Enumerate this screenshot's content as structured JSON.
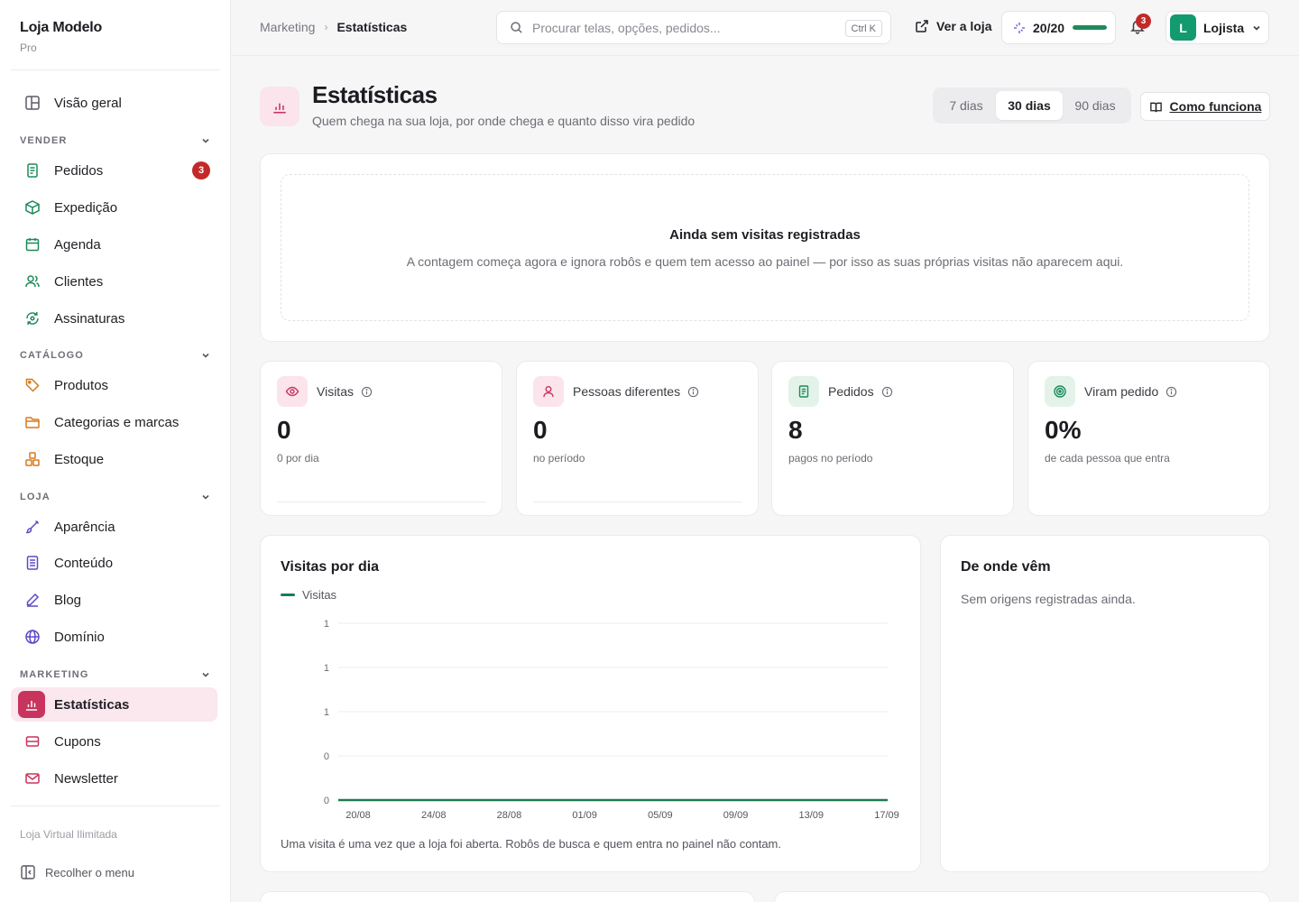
{
  "brand": {
    "name": "Loja Modelo",
    "plan": "Pro"
  },
  "sidebar": {
    "overview": "Visão geral",
    "sections": [
      {
        "title": "VENDER",
        "items": [
          {
            "label": "Pedidos",
            "icon": "receipt-icon",
            "badge": "3"
          },
          {
            "label": "Expedição",
            "icon": "box-icon"
          },
          {
            "label": "Agenda",
            "icon": "calendar-icon"
          },
          {
            "label": "Clientes",
            "icon": "users-icon"
          },
          {
            "label": "Assinaturas",
            "icon": "refresh-icon"
          }
        ]
      },
      {
        "title": "CATÁLOGO",
        "items": [
          {
            "label": "Produtos",
            "icon": "tag-icon"
          },
          {
            "label": "Categorias e marcas",
            "icon": "folder-icon"
          },
          {
            "label": "Estoque",
            "icon": "boxes-icon"
          }
        ]
      },
      {
        "title": "LOJA",
        "items": [
          {
            "label": "Aparência",
            "icon": "brush-icon"
          },
          {
            "label": "Conteúdo",
            "icon": "document-icon"
          },
          {
            "label": "Blog",
            "icon": "pen-icon"
          },
          {
            "label": "Domínio",
            "icon": "globe-icon"
          }
        ]
      },
      {
        "title": "MARKETING",
        "items": [
          {
            "label": "Estatísticas",
            "icon": "bar-chart-icon",
            "active": true
          },
          {
            "label": "Cupons",
            "icon": "coupon-icon"
          },
          {
            "label": "Newsletter",
            "icon": "mail-icon"
          }
        ]
      }
    ],
    "footer": "Loja Virtual Ilimitada",
    "collapse": "Recolher o menu"
  },
  "topbar": {
    "breadcrumb": [
      "Marketing",
      "Estatísticas"
    ],
    "search_placeholder": "Procurar telas, opções, pedidos...",
    "search_shortcut": "Ctrl K",
    "view_store": "Ver a loja",
    "score": "20/20",
    "score_fraction": 1.0,
    "notifications": "3",
    "user_initial": "L",
    "user_name": "Lojista"
  },
  "header": {
    "title": "Estatísticas",
    "subtitle": "Quem chega na sua loja, por onde chega e quanto disso vira pedido",
    "ranges": [
      "7 dias",
      "30 dias",
      "90 dias"
    ],
    "selected_range": "30 dias",
    "how_it_works": "Como funciona"
  },
  "empty_state": {
    "title": "Ainda sem visitas registradas",
    "message": "A contagem começa agora e ignora robôs e quem tem acesso ao painel — por isso as suas próprias visitas não aparecem aqui."
  },
  "stats": [
    {
      "label": "Visitas",
      "value": "0",
      "sub": "0 por dia",
      "icon": "eye-icon",
      "color": "#c8345e",
      "bg": "#fbe4ec"
    },
    {
      "label": "Pessoas diferentes",
      "value": "0",
      "sub": "no período",
      "icon": "person-icon",
      "color": "#c8345e",
      "bg": "#fbe4ec"
    },
    {
      "label": "Pedidos",
      "value": "8",
      "sub": "pagos no período",
      "icon": "receipt-icon",
      "color": "#1d8a5a",
      "bg": "#e3f3ea"
    },
    {
      "label": "Viram pedido",
      "value": "0%",
      "sub": "de cada pessoa que entra",
      "icon": "target-icon",
      "color": "#1d8a5a",
      "bg": "#e3f3ea"
    }
  ],
  "visits_chart": {
    "title": "Visitas por dia",
    "footnote": "Uma visita é uma vez que a loja foi aberta. Robôs de busca e quem entra no painel não contam."
  },
  "origins": {
    "title": "De onde vêm",
    "empty": "Sem origens registradas ainda."
  },
  "chart_data": {
    "type": "line",
    "title": "Visitas por dia",
    "series": [
      {
        "name": "Visitas",
        "values": [
          0,
          0,
          0,
          0,
          0,
          0,
          0,
          0,
          0,
          0,
          0,
          0,
          0,
          0,
          0,
          0,
          0,
          0,
          0,
          0,
          0,
          0,
          0,
          0,
          0,
          0,
          0,
          0,
          0,
          0
        ]
      }
    ],
    "x_ticks": [
      "20/08",
      "24/08",
      "28/08",
      "01/09",
      "05/09",
      "09/09",
      "13/09",
      "17/09"
    ],
    "y_tick_labels": [
      "1",
      "1",
      "1",
      "0",
      "0"
    ],
    "grid": true,
    "legend": "top-left",
    "color": "#1d7a50"
  }
}
